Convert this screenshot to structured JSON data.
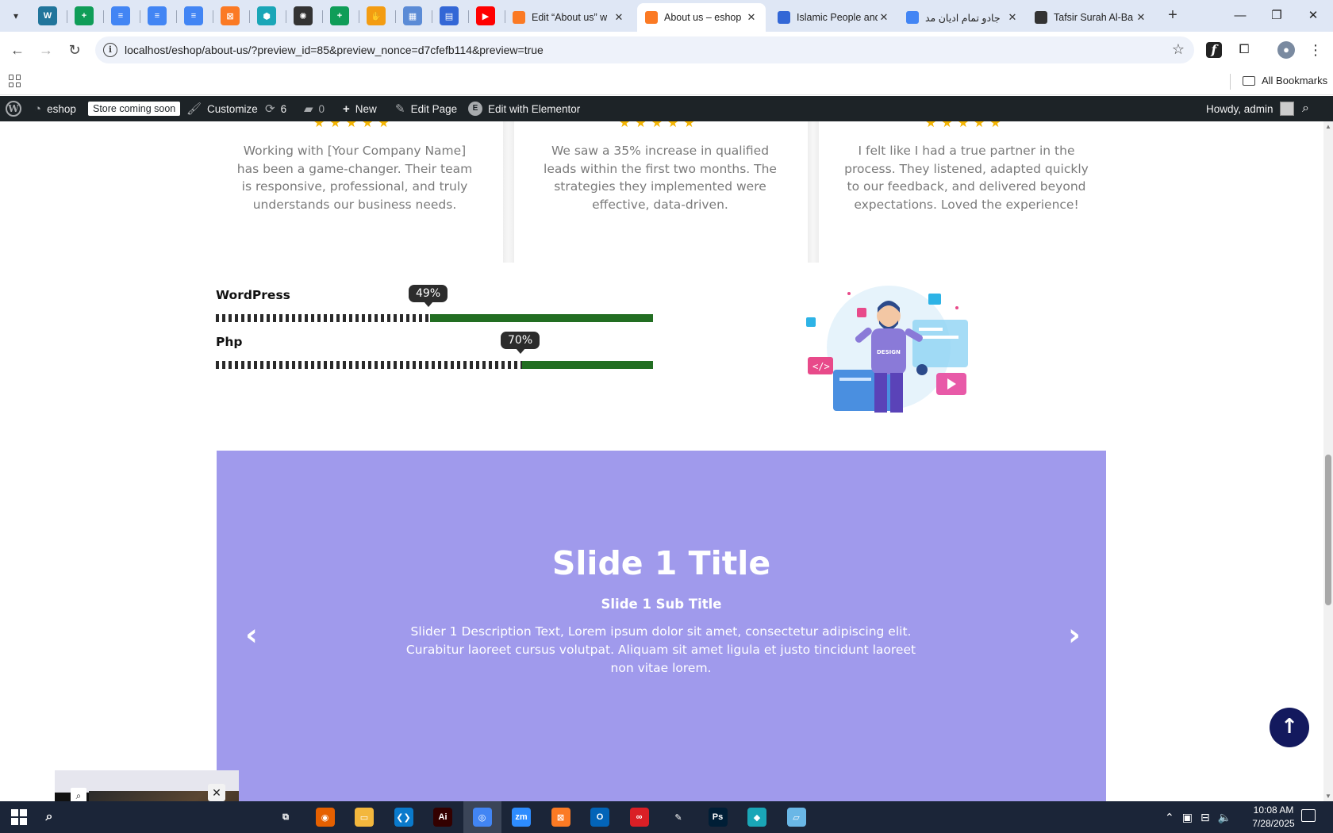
{
  "browser": {
    "pinned_tabs": [
      {
        "icon": "wordpress-icon",
        "color": "#21759b",
        "glyph": "W"
      },
      {
        "icon": "sheets-icon",
        "color": "#0f9d58",
        "glyph": "+"
      },
      {
        "icon": "docs-icon",
        "color": "#4285f4",
        "glyph": "≡"
      },
      {
        "icon": "docs-icon",
        "color": "#4285f4",
        "glyph": "≡"
      },
      {
        "icon": "docs-icon",
        "color": "#4285f4",
        "glyph": "≡"
      },
      {
        "icon": "xampp-icon",
        "color": "#fb7a24",
        "glyph": "⊠"
      },
      {
        "icon": "hexagon-app-icon",
        "color": "#1aa6b7",
        "glyph": "⬢"
      },
      {
        "icon": "openai-icon",
        "color": "#333333",
        "glyph": "✺"
      },
      {
        "icon": "sheets-icon",
        "color": "#0f9d58",
        "glyph": "+"
      },
      {
        "icon": "hand-icon",
        "color": "#f39c12",
        "glyph": "✋"
      },
      {
        "icon": "calculator-icon",
        "color": "#5b8bd6",
        "glyph": "▦"
      },
      {
        "icon": "forms-icon",
        "color": "#3367d6",
        "glyph": "▤"
      },
      {
        "icon": "youtube-icon",
        "color": "#ff0000",
        "glyph": "▶"
      }
    ],
    "tabs": [
      {
        "title": "Edit “About us” w",
        "icon": "xampp-icon",
        "color": "#fb7a24",
        "active": false
      },
      {
        "title": "About us – eshop",
        "icon": "xampp-icon",
        "color": "#fb7a24",
        "active": true
      },
      {
        "title": "Islamic People and",
        "icon": "forms-icon",
        "color": "#3367d6",
        "active": false
      },
      {
        "title": "جادو تمام ادیان مد",
        "icon": "google-icon",
        "color": "#4285f4",
        "active": false
      },
      {
        "title": "Tafsir Surah Al-Ba",
        "icon": "site-icon",
        "color": "#333333",
        "active": false
      }
    ],
    "url": "localhost/eshop/about-us/?preview_id=85&preview_nonce=d7cfefb114&preview=true",
    "all_bookmarks": "All Bookmarks"
  },
  "adminbar": {
    "site_name": "eshop",
    "store_badge": "Store coming soon",
    "customize": "Customize",
    "updates_count": "6",
    "comments_count": "0",
    "new": "New",
    "edit_page": "Edit Page",
    "edit_elementor": "Edit with Elementor",
    "howdy": "Howdy, admin"
  },
  "testimonials": [
    {
      "text": "Working with [Your Company Name] has been a game-changer. Their team is responsive, professional, and truly understands our business needs.",
      "rating": 5
    },
    {
      "text": "We saw a 35% increase in qualified leads within the first two months. The strategies they implemented were effective, data-driven.",
      "rating": 5
    },
    {
      "text": "I felt like I had a true partner in the process. They listened, adapted quickly to our feedback, and delivered beyond expectations. Loved the experience!",
      "rating": 5
    }
  ],
  "skills": [
    {
      "label": "WordPress",
      "percent": 49,
      "percent_label": "49%"
    },
    {
      "label": "Php",
      "percent": 70,
      "percent_label": "70%"
    }
  ],
  "slider": {
    "title": "Slide 1 Title",
    "subtitle": "Slide 1 Sub Title",
    "description": "Slider 1 Description Text, Lorem ipsum dolor sit amet, consectetur adipiscing elit. Curabitur laoreet cursus volutpat. Aliquam sit amet ligula et justo tincidunt laoreet non vitae lorem.",
    "background": "#a09aec"
  },
  "colors": {
    "skill_fill": "#226e22",
    "back_to_top": "#13195e",
    "admin_bar": "#1d2327"
  },
  "taskbar": {
    "time": "10:08 AM",
    "date": "7/28/2025",
    "apps": [
      {
        "icon": "task-view-icon",
        "color": "transparent",
        "glyph": "⧉"
      },
      {
        "icon": "firefox-icon",
        "color": "#e66000",
        "glyph": "◉"
      },
      {
        "icon": "file-explorer-icon",
        "color": "#f3b73d",
        "glyph": "▭"
      },
      {
        "icon": "vscode-icon",
        "color": "#0a7acc",
        "glyph": "❮❯"
      },
      {
        "icon": "illustrator-icon",
        "color": "#330000",
        "glyph": "Ai"
      },
      {
        "icon": "chrome-icon",
        "color": "#4285f4",
        "glyph": "◎"
      },
      {
        "icon": "zoom-icon",
        "color": "#2d8cff",
        "glyph": "zm"
      },
      {
        "icon": "xampp-icon",
        "color": "#fb7a24",
        "glyph": "⊠"
      },
      {
        "icon": "outlook-icon",
        "color": "#0364b8",
        "glyph": "O"
      },
      {
        "icon": "creative-cloud-icon",
        "color": "#da1f26",
        "glyph": "∞"
      },
      {
        "icon": "pen-tool-icon",
        "color": "transparent",
        "glyph": "✎"
      },
      {
        "icon": "photoshop-icon",
        "color": "#001e36",
        "glyph": "Ps"
      },
      {
        "icon": "gem-app-icon",
        "color": "#1aa6b7",
        "glyph": "◆"
      },
      {
        "icon": "notepad-icon",
        "color": "#6ab7e6",
        "glyph": "▱"
      }
    ]
  }
}
